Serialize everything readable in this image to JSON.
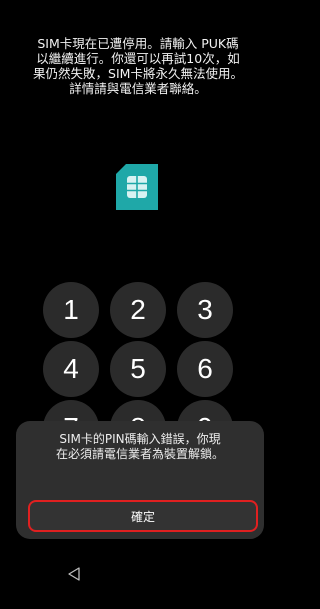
{
  "message": {
    "lines": [
      "SIM卡現在已遭停用。請輸入 PUK碼",
      "以繼續進行。你還可以再試10次，如",
      "果仍然失敗，SIM卡將永久無法使用。",
      "詳情請與電信業者聯絡。"
    ]
  },
  "keypad": {
    "keys": [
      "1",
      "2",
      "3",
      "4",
      "5",
      "6",
      "7",
      "8",
      "9"
    ]
  },
  "dialog": {
    "lines": [
      "SIM卡的PIN碼輸入錯誤，你現",
      "在必須請電信業者為裝置解鎖。"
    ],
    "confirm_label": "確定"
  },
  "icons": {
    "sim": "sim-card-icon",
    "back": "back-triangle-icon"
  },
  "colors": {
    "background": "#000000",
    "sim_icon": "#1fa8a8",
    "key_bg": "#2b2b2b",
    "dialog_bg": "#2f2f2f",
    "highlight": "#e02020"
  }
}
